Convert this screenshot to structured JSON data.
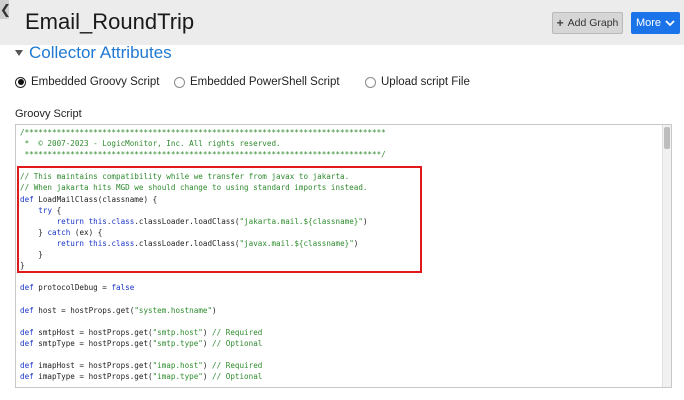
{
  "header": {
    "collapse_glyph": "❮",
    "title": "Email_RoundTrip",
    "add_graph_label": "Add Graph",
    "add_graph_icon": "plus-icon",
    "more_label": "More",
    "more_icon": "chevron-down-icon"
  },
  "section": {
    "title": "Collector Attributes",
    "toggle_icon": "caret-down-icon"
  },
  "script_type": {
    "options": [
      {
        "label": "Embedded Groovy Script",
        "selected": true
      },
      {
        "label": "Embedded PowerShell Script",
        "selected": false
      },
      {
        "label": "Upload script File",
        "selected": false
      }
    ]
  },
  "editor": {
    "label": "Groovy Script",
    "lines": [
      [
        {
          "t": "c",
          "v": "/*******************************************************************************"
        }
      ],
      [
        {
          "t": "c",
          "v": " *  © 2007-2023 - LogicMonitor, Inc. All rights reserved."
        }
      ],
      [
        {
          "t": "c",
          "v": " ******************************************************************************/"
        }
      ],
      [],
      [
        {
          "t": "c",
          "v": "// This maintains compatibility while we transfer from javax to jakarta."
        }
      ],
      [
        {
          "t": "c",
          "v": "// When jakarta hits MGD we should change to using standard imports instead."
        }
      ],
      [
        {
          "t": "k",
          "v": "def"
        },
        {
          "t": "p",
          "v": " LoadMailClass(classname) {"
        }
      ],
      [
        {
          "t": "p",
          "v": "    "
        },
        {
          "t": "k",
          "v": "try"
        },
        {
          "t": "p",
          "v": " {"
        }
      ],
      [
        {
          "t": "p",
          "v": "        "
        },
        {
          "t": "k",
          "v": "return"
        },
        {
          "t": "p",
          "v": " "
        },
        {
          "t": "k",
          "v": "this"
        },
        {
          "t": "p",
          "v": "."
        },
        {
          "t": "k",
          "v": "class"
        },
        {
          "t": "p",
          "v": ".classLoader.loadClass("
        },
        {
          "t": "s",
          "v": "\"jakarta.mail.${classname}\""
        },
        {
          "t": "p",
          "v": ")"
        }
      ],
      [
        {
          "t": "p",
          "v": "    } "
        },
        {
          "t": "k",
          "v": "catch"
        },
        {
          "t": "p",
          "v": " (ex) {"
        }
      ],
      [
        {
          "t": "p",
          "v": "        "
        },
        {
          "t": "k",
          "v": "return"
        },
        {
          "t": "p",
          "v": " "
        },
        {
          "t": "k",
          "v": "this"
        },
        {
          "t": "p",
          "v": "."
        },
        {
          "t": "k",
          "v": "class"
        },
        {
          "t": "p",
          "v": ".classLoader.loadClass("
        },
        {
          "t": "s",
          "v": "\"javax.mail.${classname}\""
        },
        {
          "t": "p",
          "v": ")"
        }
      ],
      [
        {
          "t": "p",
          "v": "    }"
        }
      ],
      [
        {
          "t": "p",
          "v": "}"
        }
      ],
      [],
      [
        {
          "t": "k",
          "v": "def"
        },
        {
          "t": "p",
          "v": " protocolDebug = "
        },
        {
          "t": "k",
          "v": "false"
        }
      ],
      [],
      [
        {
          "t": "k",
          "v": "def"
        },
        {
          "t": "p",
          "v": " host = hostProps.get("
        },
        {
          "t": "s",
          "v": "\"system.hostname\""
        },
        {
          "t": "p",
          "v": ")"
        }
      ],
      [],
      [
        {
          "t": "k",
          "v": "def"
        },
        {
          "t": "p",
          "v": " smtpHost = hostProps.get("
        },
        {
          "t": "s",
          "v": "\"smtp.host\""
        },
        {
          "t": "p",
          "v": ") "
        },
        {
          "t": "c",
          "v": "// Required"
        }
      ],
      [
        {
          "t": "k",
          "v": "def"
        },
        {
          "t": "p",
          "v": " smtpType = hostProps.get("
        },
        {
          "t": "s",
          "v": "\"smtp.type\""
        },
        {
          "t": "p",
          "v": ") "
        },
        {
          "t": "c",
          "v": "// Optional"
        }
      ],
      [],
      [
        {
          "t": "k",
          "v": "def"
        },
        {
          "t": "p",
          "v": " imapHost = hostProps.get("
        },
        {
          "t": "s",
          "v": "\"imap.host\""
        },
        {
          "t": "p",
          "v": ") "
        },
        {
          "t": "c",
          "v": "// Required"
        }
      ],
      [
        {
          "t": "k",
          "v": "def"
        },
        {
          "t": "p",
          "v": " imapType = hostProps.get("
        },
        {
          "t": "s",
          "v": "\"imap.type\""
        },
        {
          "t": "p",
          "v": ") "
        },
        {
          "t": "c",
          "v": "// Optional"
        }
      ]
    ]
  },
  "colors": {
    "accent": "#1a73e8",
    "section_title": "#1f78d1",
    "highlight_border": "#e0191a",
    "comment": "#2f8a2f",
    "keyword": "#1a35c9"
  }
}
